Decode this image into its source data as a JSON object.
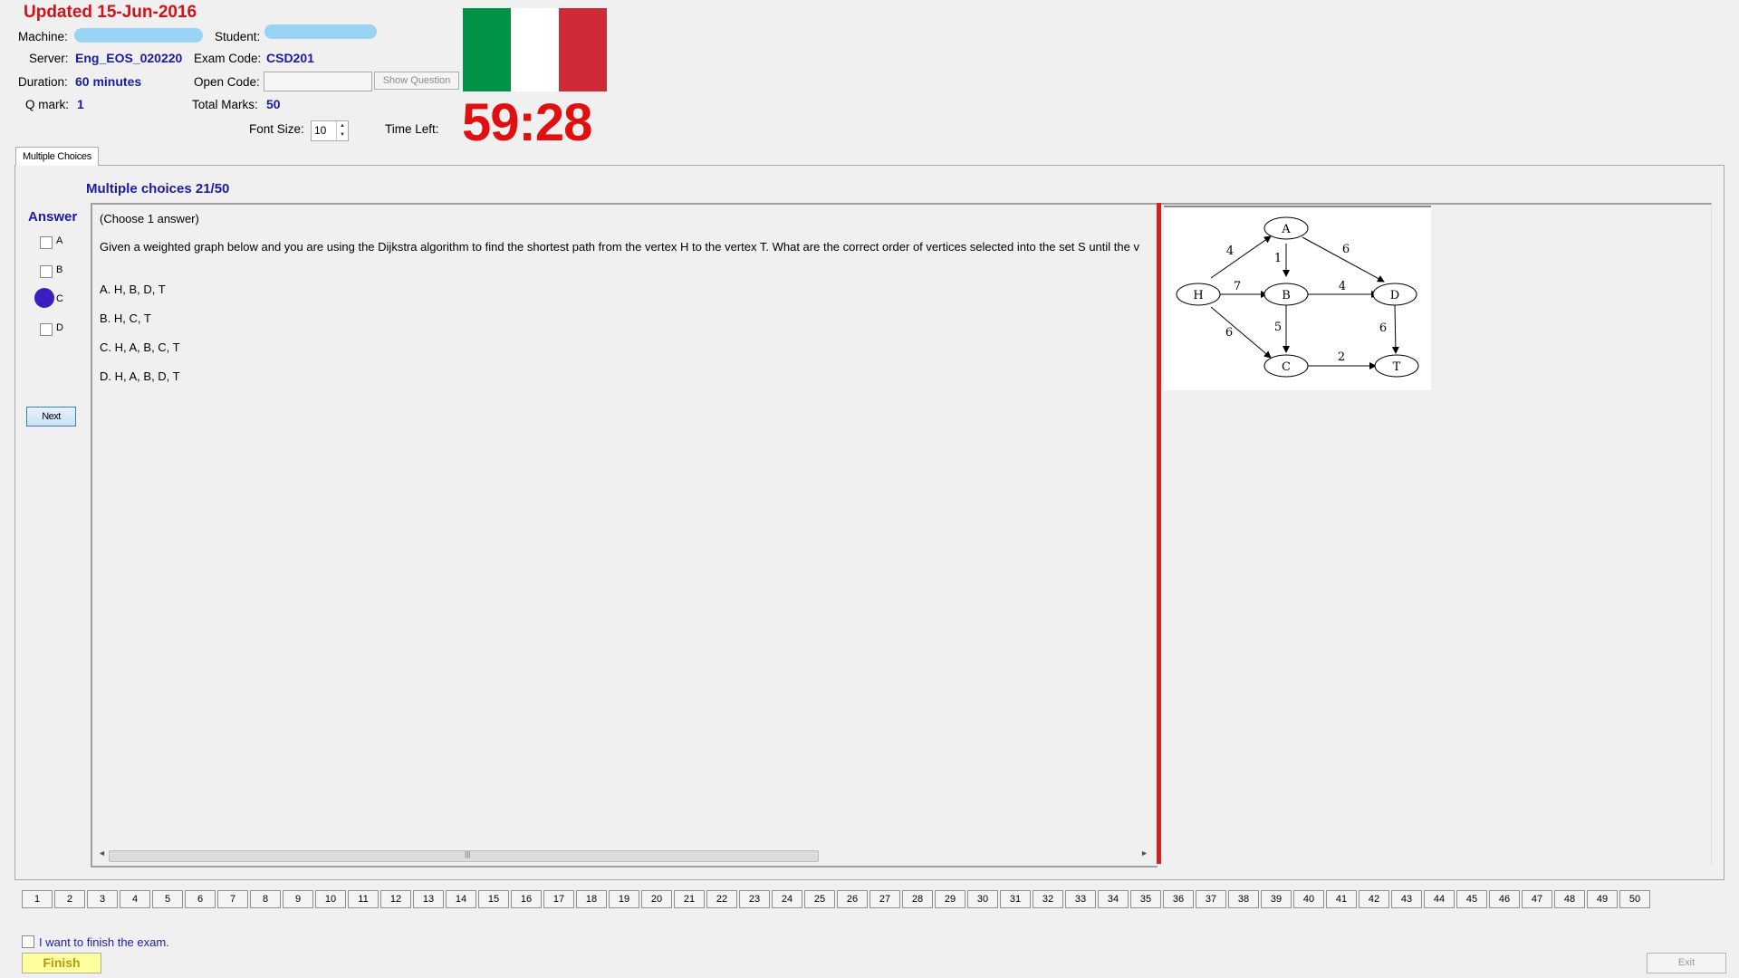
{
  "header": {
    "updated": "Updated 15-Jun-2016",
    "machine_label": "Machine:",
    "student_label": "Student:",
    "server_label": "Server:",
    "server_value": "Eng_EOS_020220",
    "exam_code_label": "Exam Code:",
    "exam_code_value": "CSD201",
    "duration_label": "Duration:",
    "duration_value": "60 minutes",
    "open_code_label": "Open Code:",
    "open_code_value": "",
    "show_question": "Show Question",
    "qmark_label": "Q mark:",
    "qmark_value": "1",
    "total_marks_label": "Total Marks:",
    "total_marks_value": "50",
    "font_size_label": "Font Size:",
    "font_size_value": "10",
    "time_left_label": "Time Left:",
    "timer": "59:28",
    "flag_colors": [
      "#009246",
      "#ffffff",
      "#ce2b37"
    ]
  },
  "tab": {
    "label": "Multiple Choices"
  },
  "question": {
    "title": "Multiple choices 21/50",
    "instruction": "(Choose 1 answer)",
    "text": "Given a weighted graph below and you are using the Dijkstra algorithm to find the shortest path from the vertex  H  to the vertex  T. What are the correct order of vertices selected into the set  S until the v",
    "options": [
      "A.  H, B, D, T",
      "B.  H, C, T",
      "C.  H, A, B, C, T",
      "D.  H, A, B, D, T"
    ]
  },
  "answer": {
    "title": "Answer",
    "choices": [
      "A",
      "B",
      "C",
      "D"
    ],
    "selected": "C",
    "next": "Next"
  },
  "graph": {
    "nodes": [
      "A",
      "H",
      "B",
      "D",
      "C",
      "T"
    ],
    "edges": [
      {
        "from": "H",
        "to": "A",
        "w": "4"
      },
      {
        "from": "A",
        "to": "B",
        "w": "1"
      },
      {
        "from": "A",
        "to": "D",
        "w": "6"
      },
      {
        "from": "H",
        "to": "B",
        "w": "7"
      },
      {
        "from": "B",
        "to": "D",
        "w": "4"
      },
      {
        "from": "H",
        "to": "C",
        "w": "6"
      },
      {
        "from": "B",
        "to": "C",
        "w": "5"
      },
      {
        "from": "D",
        "to": "T",
        "w": "6"
      },
      {
        "from": "C",
        "to": "T",
        "w": "2"
      }
    ]
  },
  "nav": {
    "questions": [
      "1",
      "2",
      "3",
      "4",
      "5",
      "6",
      "7",
      "8",
      "9",
      "10",
      "11",
      "12",
      "13",
      "14",
      "15",
      "16",
      "17",
      "18",
      "19",
      "20",
      "21",
      "22",
      "23",
      "24",
      "25",
      "26",
      "27",
      "28",
      "29",
      "30",
      "31",
      "32",
      "33",
      "34",
      "35",
      "36",
      "37",
      "38",
      "39",
      "40",
      "41",
      "42",
      "43",
      "44",
      "45",
      "46",
      "47",
      "48",
      "49",
      "50"
    ]
  },
  "footer": {
    "finish_check_label": "I want to finish the exam.",
    "finish": "Finish",
    "exit": "Exit"
  }
}
